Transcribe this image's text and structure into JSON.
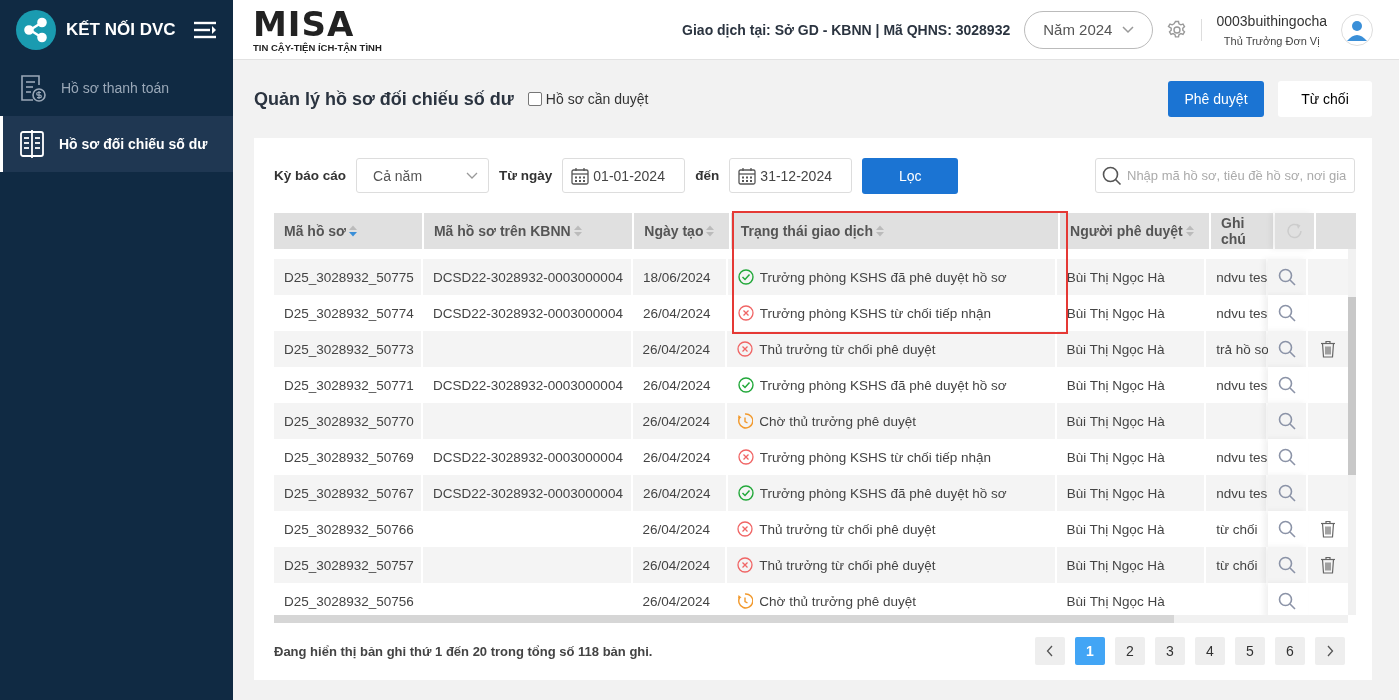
{
  "sidebar": {
    "title": "KẾT NỐI DVC",
    "items": [
      {
        "label": "Hồ sơ thanh toán",
        "selected": false,
        "kind": "payment"
      },
      {
        "label": "Hồ sơ đối chiếu số dư",
        "selected": true,
        "kind": "ledger"
      }
    ]
  },
  "header": {
    "logo_text": "MISA",
    "logo_tagline": "TIN CẬY-TIỆN ÍCH-TẬN TÌNH",
    "transaction_info": "Giao dịch tại: Sở GD - KBNN | Mã QHNS: 3028932",
    "year": "Năm 2024",
    "user_name": "0003buithingocha",
    "user_role": "Thủ Trưởng Đơn Vị"
  },
  "page": {
    "title": "Quản lý hồ sơ đối chiếu số dư",
    "pending_filter": {
      "label": "Hồ sơ cần duyệt",
      "checked": false
    },
    "approve_button": "Phê duyệt",
    "reject_button": "Từ chối"
  },
  "filters": {
    "period_label": "Kỳ báo cáo",
    "period": "Cả năm",
    "from_label": "Từ ngày",
    "from_date": "01-01-2024",
    "to_label": "đến",
    "to_date": "31-12-2024",
    "filter_button": "Lọc",
    "search": {
      "placeholder": "Nhập mã hồ sơ, tiêu đề hồ sơ, nơi gia"
    }
  },
  "table": {
    "columns": [
      {
        "label": "Mã hồ sơ",
        "sorted": true
      },
      {
        "label": "Mã hồ sơ trên KBNN",
        "sorted": false
      },
      {
        "label": "Ngày tạo",
        "sorted": false
      },
      {
        "label": "Trạng thái giao dịch",
        "sorted": false
      },
      {
        "label": "Người phê duyệt",
        "sorted": false
      },
      {
        "label": "Ghi chú"
      }
    ],
    "highlight_frame": true,
    "rows": [
      {
        "id": "D25_3028932_50775",
        "kbnn_id": "DCSD22-3028932-0003000004",
        "created": "18/06/2024",
        "status": "Trưởng phòng KSHS đã phê duyệt hồ sơ",
        "kind": "approved",
        "approver": "Bùi Thị Ngọc Hà",
        "note": "ndvu tes",
        "deletable": false
      },
      {
        "id": "D25_3028932_50774",
        "kbnn_id": "DCSD22-3028932-0003000004",
        "created": "26/04/2024",
        "status": "Trưởng phòng KSHS từ chối tiếp nhận",
        "kind": "rejected",
        "approver": "Bùi Thị Ngọc Hà",
        "note": "ndvu tes",
        "deletable": false
      },
      {
        "id": "D25_3028932_50773",
        "created": "26/04/2024",
        "status": "Thủ trưởng từ chối phê duyệt",
        "kind": "rejected",
        "approver": "Bùi Thị Ngọc Hà",
        "note": "trả hồ sơ",
        "deletable": true
      },
      {
        "id": "D25_3028932_50771",
        "kbnn_id": "DCSD22-3028932-0003000004",
        "created": "26/04/2024",
        "status": "Trưởng phòng KSHS đã phê duyệt hồ sơ",
        "kind": "approved",
        "approver": "Bùi Thị Ngọc Hà",
        "note": "ndvu tes",
        "deletable": false
      },
      {
        "id": "D25_3028932_50770",
        "created": "26/04/2024",
        "status": "Chờ thủ trưởng phê duyệt",
        "kind": "pending",
        "approver": "Bùi Thị Ngọc Hà",
        "deletable": false
      },
      {
        "id": "D25_3028932_50769",
        "kbnn_id": "DCSD22-3028932-0003000004",
        "created": "26/04/2024",
        "status": "Trưởng phòng KSHS từ chối tiếp nhận",
        "kind": "rejected",
        "approver": "Bùi Thị Ngọc Hà",
        "note": "ndvu tes",
        "deletable": false
      },
      {
        "id": "D25_3028932_50767",
        "kbnn_id": "DCSD22-3028932-0003000004",
        "created": "26/04/2024",
        "status": "Trưởng phòng KSHS đã phê duyệt hồ sơ",
        "kind": "approved",
        "approver": "Bùi Thị Ngọc Hà",
        "note": "ndvu tes",
        "deletable": false
      },
      {
        "id": "D25_3028932_50766",
        "created": "26/04/2024",
        "status": "Thủ trưởng từ chối phê duyệt",
        "kind": "rejected",
        "approver": "Bùi Thị Ngọc Hà",
        "note": "từ chối",
        "deletable": true
      },
      {
        "id": "D25_3028932_50757",
        "created": "26/04/2024",
        "status": "Thủ trưởng từ chối phê duyệt",
        "kind": "rejected",
        "approver": "Bùi Thị Ngọc Hà",
        "note": "từ chối",
        "deletable": true
      },
      {
        "id": "D25_3028932_50756",
        "created": "26/04/2024",
        "status": "Chờ thủ trưởng phê duyệt",
        "kind": "pending",
        "approver": "Bùi Thị Ngọc Hà",
        "deletable": false
      }
    ]
  },
  "footer": {
    "summary": "Đang hiển thị bản ghi thứ 1 đến 20 trong tổng số 118 bản ghi.",
    "pages": [
      {
        "label": "1",
        "selected": true
      },
      {
        "label": "2",
        "selected": false
      },
      {
        "label": "3",
        "selected": false
      },
      {
        "label": "4",
        "selected": false
      },
      {
        "label": "5",
        "selected": false
      },
      {
        "label": "6",
        "selected": false
      }
    ]
  }
}
